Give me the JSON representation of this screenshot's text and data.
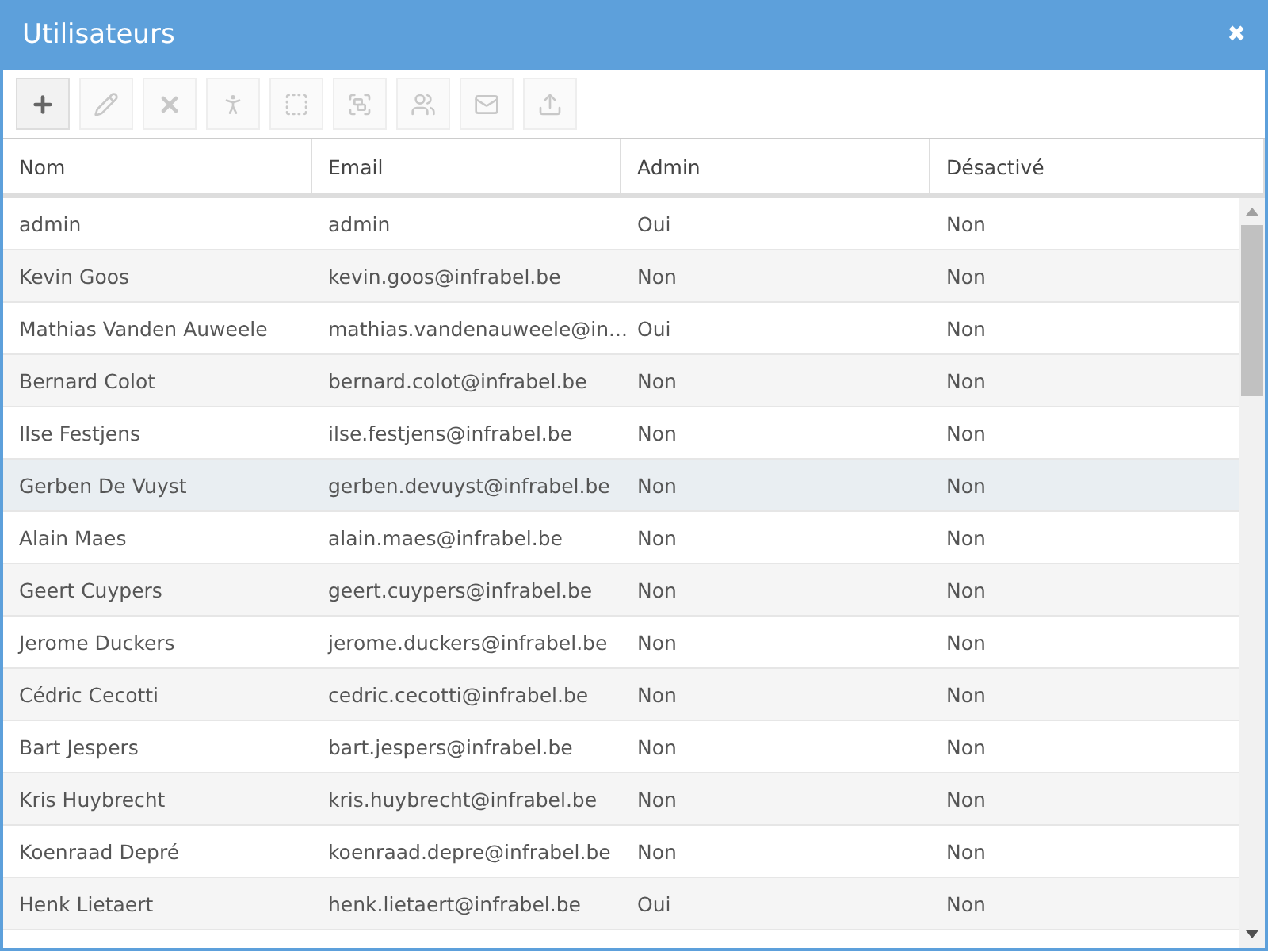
{
  "window": {
    "title": "Utilisateurs",
    "close": "✖"
  },
  "toolbar": [
    {
      "kind": "add",
      "disabled": false
    },
    {
      "kind": "edit",
      "disabled": true
    },
    {
      "kind": "delete",
      "disabled": true
    },
    {
      "kind": "person",
      "disabled": true
    },
    {
      "kind": "vector",
      "disabled": true
    },
    {
      "kind": "group",
      "disabled": true
    },
    {
      "kind": "users",
      "disabled": true
    },
    {
      "kind": "mail",
      "disabled": true
    },
    {
      "kind": "upload",
      "disabled": true
    }
  ],
  "table": {
    "columns": [
      "Nom",
      "Email",
      "Admin",
      "Désactivé"
    ],
    "rows": [
      {
        "cells": [
          "admin",
          "admin",
          "Oui",
          "Non"
        ],
        "selected": false
      },
      {
        "cells": [
          "Kevin Goos",
          "kevin.goos@infrabel.be",
          "Non",
          "Non"
        ],
        "selected": false
      },
      {
        "cells": [
          "Mathias Vanden Auweele",
          "mathias.vandenauweele@in...",
          "Oui",
          "Non"
        ],
        "selected": false
      },
      {
        "cells": [
          "Bernard Colot",
          "bernard.colot@infrabel.be",
          "Non",
          "Non"
        ],
        "selected": false
      },
      {
        "cells": [
          "Ilse Festjens",
          "ilse.festjens@infrabel.be",
          "Non",
          "Non"
        ],
        "selected": false
      },
      {
        "cells": [
          "Gerben De Vuyst",
          "gerben.devuyst@infrabel.be",
          "Non",
          "Non"
        ],
        "selected": true
      },
      {
        "cells": [
          "Alain Maes",
          "alain.maes@infrabel.be",
          "Non",
          "Non"
        ],
        "selected": false
      },
      {
        "cells": [
          "Geert Cuypers",
          "geert.cuypers@infrabel.be",
          "Non",
          "Non"
        ],
        "selected": false
      },
      {
        "cells": [
          "Jerome Duckers",
          "jerome.duckers@infrabel.be",
          "Non",
          "Non"
        ],
        "selected": false
      },
      {
        "cells": [
          "Cédric Cecotti",
          "cedric.cecotti@infrabel.be",
          "Non",
          "Non"
        ],
        "selected": false
      },
      {
        "cells": [
          "Bart Jespers",
          "bart.jespers@infrabel.be",
          "Non",
          "Non"
        ],
        "selected": false
      },
      {
        "cells": [
          "Kris Huybrecht",
          "kris.huybrecht@infrabel.be",
          "Non",
          "Non"
        ],
        "selected": false
      },
      {
        "cells": [
          "Koenraad Depré",
          "koenraad.depre@infrabel.be",
          "Non",
          "Non"
        ],
        "selected": false
      },
      {
        "cells": [
          "Henk Lietaert",
          "henk.lietaert@infrabel.be",
          "Oui",
          "Non"
        ],
        "selected": false
      }
    ]
  }
}
